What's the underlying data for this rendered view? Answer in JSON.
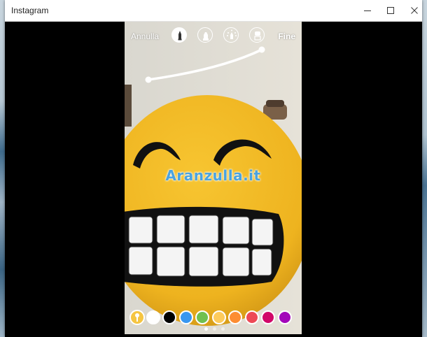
{
  "window": {
    "title": "Instagram",
    "controls": [
      "minimize-icon",
      "maximize-icon",
      "close-icon"
    ]
  },
  "editor": {
    "cancel_label": "Annulla",
    "done_label": "Fine",
    "tools": [
      {
        "icon": "pen-icon",
        "selected": true
      },
      {
        "icon": "marker-icon",
        "selected": false
      },
      {
        "icon": "neon-brush-icon",
        "selected": false
      },
      {
        "icon": "eraser-icon",
        "selected": false
      }
    ],
    "colors": [
      "#f5c542",
      "#ffffff",
      "#000000",
      "#3897f0",
      "#70c050",
      "#fdcb5c",
      "#fd8d32",
      "#ed4956",
      "#d10869",
      "#a307ba"
    ],
    "selected_color_index": 0,
    "page_dots": {
      "count": 3,
      "active": 0
    }
  },
  "photo": {
    "watermark": "Aranzulla.it",
    "subject": "smiling-emoji-pillow"
  }
}
